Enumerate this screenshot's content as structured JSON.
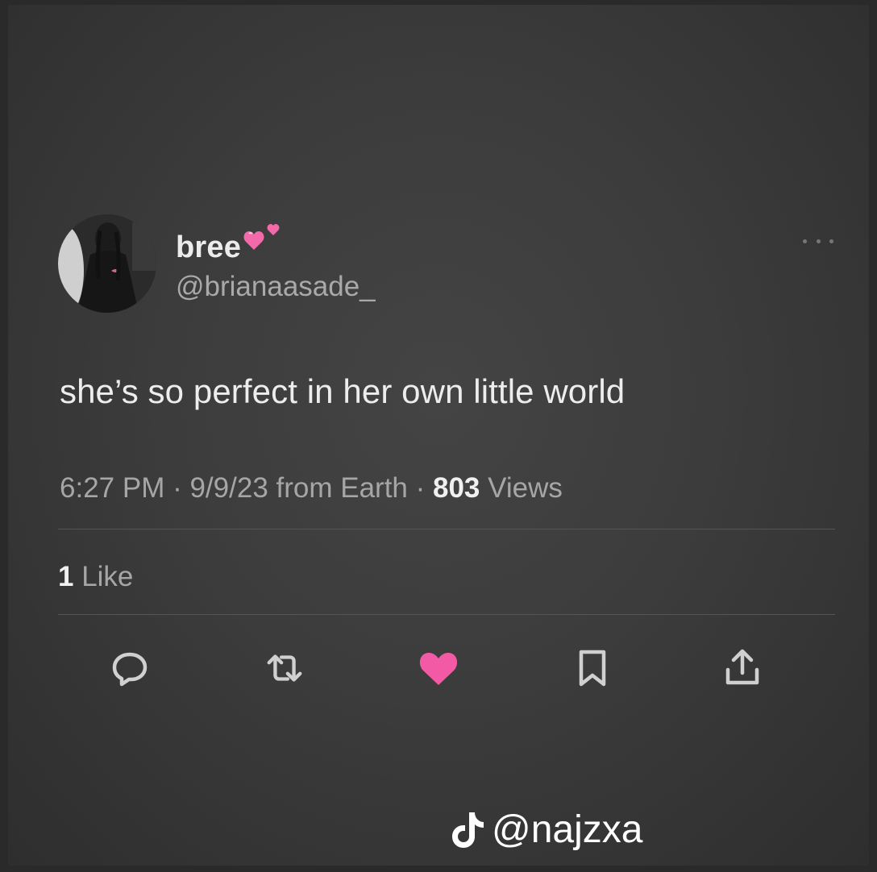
{
  "tweet": {
    "author": {
      "display_name": "bree",
      "name_emoji": "two-pink-hearts",
      "handle": "@brianaasade_"
    },
    "text": "she’s so perfect in her own little world",
    "meta": {
      "time": "6:27 PM",
      "separator1": " · ",
      "date": "9/9/23",
      "source": " from Earth",
      "separator2": " · ",
      "views_count": "803",
      "views_label": " Views"
    },
    "likes": {
      "count": "1",
      "label": " Like"
    },
    "actions": [
      "reply-icon",
      "retweet-icon",
      "like-icon",
      "bookmark-icon",
      "share-icon"
    ]
  },
  "watermark": {
    "text": "@najzxa",
    "icon": "tiktok-icon"
  },
  "colors": {
    "background": "#3c3c3c",
    "text_primary": "#ededed",
    "text_secondary": "#a6a6a6",
    "like_active": "#f25aa6",
    "icon_muted": "#d0d0d0",
    "divider": "#555555"
  }
}
